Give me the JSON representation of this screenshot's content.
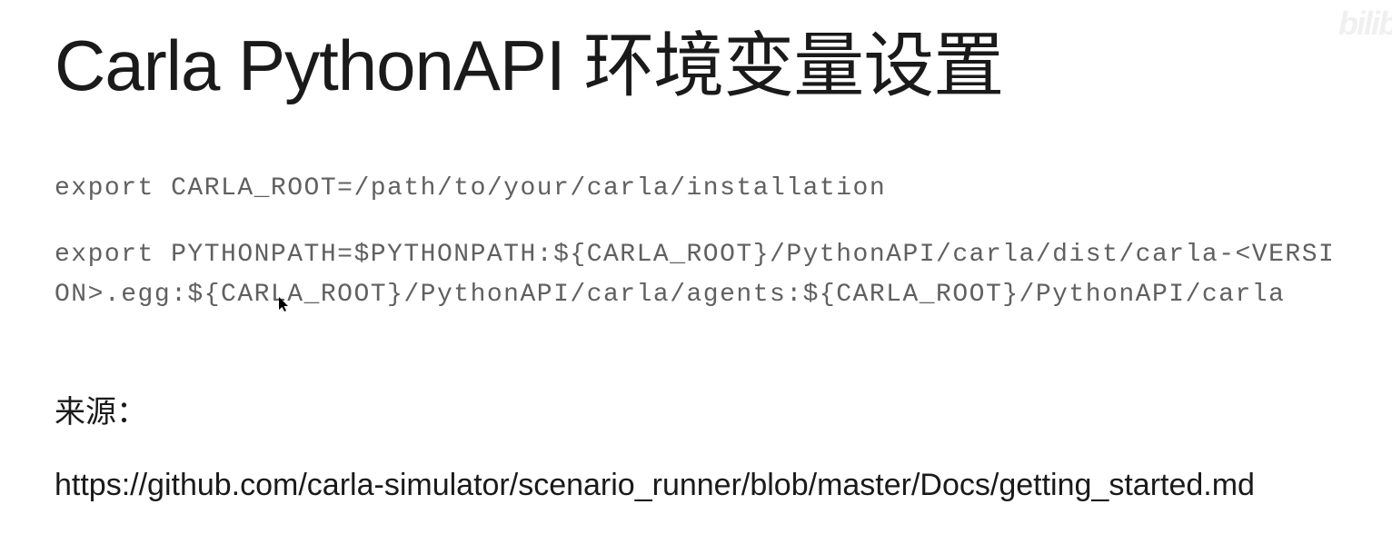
{
  "title": "Carla PythonAPI 环境变量设置",
  "code_line_1": "export CARLA_ROOT=/path/to/your/carla/installation",
  "code_line_2": "export PYTHONPATH=$PYTHONPATH:${CARLA_ROOT}/PythonAPI/carla/dist/carla-<VERSION>.egg:${CARLA_ROOT}/PythonAPI/carla/agents:${CARLA_ROOT}/PythonAPI/carla",
  "source_label": "来源：",
  "source_url": "https://github.com/carla-simulator/scenario_runner/blob/master/Docs/getting_started.md",
  "watermark": "bilib"
}
